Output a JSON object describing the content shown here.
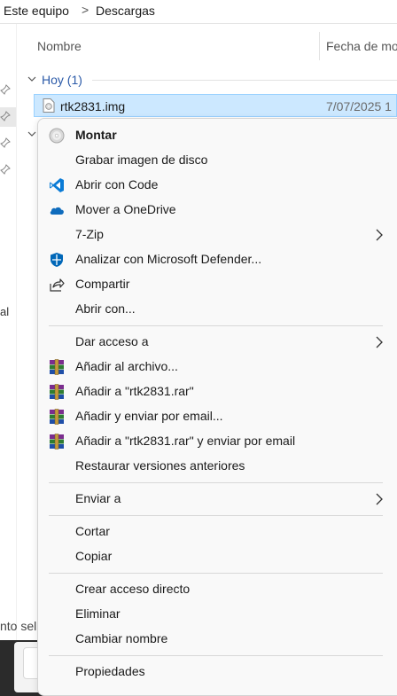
{
  "breadcrumb": {
    "item1": "Este equipo",
    "item2": "Descargas",
    "separator": ">"
  },
  "columns": {
    "name": "Nombre",
    "date": "Fecha de mo"
  },
  "group": {
    "label": "Hoy (1)"
  },
  "file": {
    "name": "rtk2831.img",
    "date": "7/07/2025 1"
  },
  "nav_fragments": {
    "frag1": "al",
    "status": "nto sel"
  },
  "menu": {
    "items": [
      {
        "label": "Montar",
        "icon": "disc-icon",
        "bold": true
      },
      {
        "label": "Grabar imagen de disco",
        "icon": ""
      },
      {
        "label": "Abrir con Code",
        "icon": "vscode-icon"
      },
      {
        "label": "Mover a OneDrive",
        "icon": "onedrive-icon"
      },
      {
        "label": "7-Zip",
        "icon": "",
        "submenu": true
      },
      {
        "label": "Analizar con Microsoft Defender...",
        "icon": "defender-icon"
      },
      {
        "label": "Compartir",
        "icon": "share-icon"
      },
      {
        "label": "Abrir con...",
        "icon": ""
      },
      {
        "label": "Dar acceso a",
        "icon": "",
        "submenu": true
      },
      {
        "label": "Añadir al archivo...",
        "icon": "winrar-icon"
      },
      {
        "label": "Añadir a \"rtk2831.rar\"",
        "icon": "winrar-icon"
      },
      {
        "label": "Añadir y enviar por email...",
        "icon": "winrar-icon"
      },
      {
        "label": "Añadir a \"rtk2831.rar\" y enviar por email",
        "icon": "winrar-icon"
      },
      {
        "label": "Restaurar versiones anteriores",
        "icon": ""
      },
      {
        "label": "Enviar a",
        "icon": "",
        "submenu": true
      },
      {
        "label": "Cortar",
        "icon": ""
      },
      {
        "label": "Copiar",
        "icon": ""
      },
      {
        "label": "Crear acceso directo",
        "icon": ""
      },
      {
        "label": "Eliminar",
        "icon": ""
      },
      {
        "label": "Cambiar nombre",
        "icon": ""
      },
      {
        "label": "Propiedades",
        "icon": ""
      }
    ]
  },
  "colors": {
    "selection": "#cce8ff",
    "selection_border": "#99d1ff",
    "menu_bg": "#f9f9f9",
    "group_header": "#2b5aa8",
    "vscode_blue": "#0a7bd6",
    "onedrive_blue": "#0f6cbd",
    "defender_blue": "#0067b8"
  }
}
